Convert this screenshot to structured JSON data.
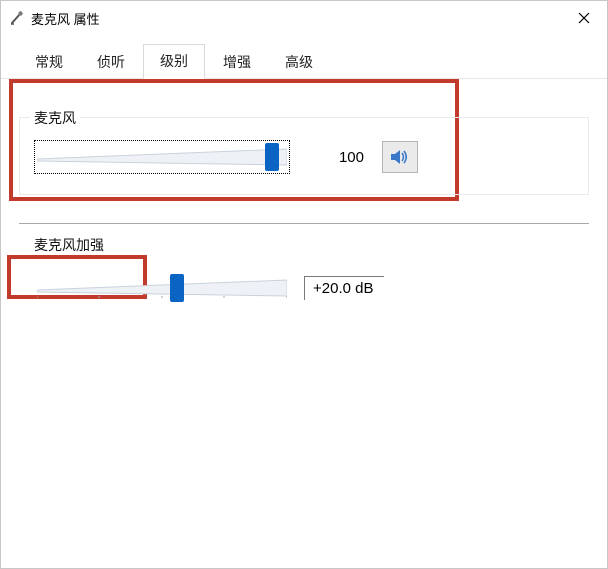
{
  "window": {
    "title": "麦克风 属性",
    "close": "×"
  },
  "tabs": {
    "general": "常规",
    "listen": "侦听",
    "levels": "级别",
    "enhance": "增强",
    "advanced": "高级"
  },
  "mic": {
    "label": "麦克风",
    "value": "100",
    "slider_percent": 94
  },
  "boost": {
    "label": "麦克风加强",
    "value": "+20.0 dB",
    "slider_percent": 56
  },
  "icons": {
    "app": "mic-icon",
    "speaker": "speaker-icon"
  }
}
